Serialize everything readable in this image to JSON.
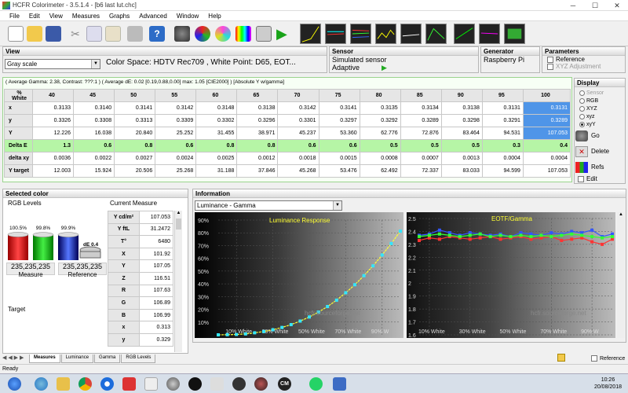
{
  "window": {
    "title": "HCFR Colorimeter - 3.5.1.4 - [b6 last lut.chc]"
  },
  "menu": [
    "File",
    "Edit",
    "View",
    "Measures",
    "Graphs",
    "Advanced",
    "Window",
    "Help"
  ],
  "view": {
    "header": "View",
    "mode": "Gray scale",
    "colorspace": "Color Space: HDTV Rec709 , White Point: D65, EOT..."
  },
  "sensor": {
    "header": "Sensor",
    "name": "Simulated sensor",
    "mode": "Adaptive"
  },
  "generator": {
    "header": "Generator",
    "name": "Raspberry Pi"
  },
  "parameters": {
    "header": "Parameters",
    "reference": "Reference",
    "xyz_adjust": "XYZ Adjustment"
  },
  "grid": {
    "summary": "( Average Gamma: 2.38, Contrast: ???:1 ) ( Average dE: 0.02 [0.19,0.88,0.00] max: 1.05 [CIE2000] ) [Absolute Y w/gamma]",
    "corner": "% White",
    "columns": [
      "40",
      "45",
      "50",
      "55",
      "60",
      "65",
      "70",
      "75",
      "80",
      "85",
      "90",
      "95",
      "100"
    ],
    "rows": [
      {
        "label": "x",
        "values": [
          "0.3133",
          "0.3140",
          "0.3141",
          "0.3142",
          "0.3148",
          "0.3138",
          "0.3142",
          "0.3141",
          "0.3135",
          "0.3134",
          "0.3138",
          "0.3131",
          "0.3131"
        ]
      },
      {
        "label": "y",
        "values": [
          "0.3326",
          "0.3308",
          "0.3313",
          "0.3309",
          "0.3302",
          "0.3296",
          "0.3301",
          "0.3297",
          "0.3292",
          "0.3289",
          "0.3298",
          "0.3291",
          "0.3289"
        ]
      },
      {
        "label": "Y",
        "values": [
          "12.226",
          "16.038",
          "20.840",
          "25.252",
          "31.455",
          "38.971",
          "45.237",
          "53.360",
          "62.776",
          "72.876",
          "83.464",
          "94.531",
          "107.053"
        ]
      },
      {
        "label": "Delta E",
        "values": [
          "1.3",
          "0.6",
          "0.8",
          "0.6",
          "0.8",
          "0.8",
          "0.6",
          "0.6",
          "0.5",
          "0.5",
          "0.5",
          "0.3",
          "0.4"
        ]
      },
      {
        "label": "delta xy",
        "values": [
          "0.0036",
          "0.0022",
          "0.0027",
          "0.0024",
          "0.0025",
          "0.0012",
          "0.0018",
          "0.0015",
          "0.0008",
          "0.0007",
          "0.0013",
          "0.0004",
          "0.0004"
        ]
      },
      {
        "label": "Y target",
        "values": [
          "12.003",
          "15.924",
          "20.506",
          "25.268",
          "31.188",
          "37.846",
          "45.268",
          "53.476",
          "62.492",
          "72.337",
          "83.033",
          "94.599",
          "107.053"
        ]
      }
    ]
  },
  "display_panel": {
    "header": "Display",
    "options": [
      "Sensor",
      "RGB",
      "XYZ",
      "xyz",
      "xyY"
    ],
    "go": "Go",
    "delete": "Delete",
    "refs": "Refs",
    "edit": "Edit"
  },
  "selected": {
    "header": "Selected color",
    "rgb_levels": "RGB Levels",
    "bars": [
      {
        "label": "100.5%",
        "value": 100.5
      },
      {
        "label": "99.8%",
        "value": 99.8
      },
      {
        "label": "99.9%",
        "value": 99.9
      }
    ],
    "de": "dE 0.4",
    "measure_value": "235,235,235",
    "measure_label": "Measure",
    "reference_value": "235,235,235",
    "reference_label": "Reference",
    "target": "Target",
    "current_header": "Current Measure",
    "measures": [
      {
        "label": "Y cd/m²",
        "value": "107.053"
      },
      {
        "label": "Y ftL",
        "value": "31.2472"
      },
      {
        "label": "T°",
        "value": "6480"
      },
      {
        "label": "X",
        "value": "101.92"
      },
      {
        "label": "Y",
        "value": "107.05"
      },
      {
        "label": "Z",
        "value": "116.51"
      },
      {
        "label": "R",
        "value": "107.63"
      },
      {
        "label": "G",
        "value": "106.89"
      },
      {
        "label": "B",
        "value": "106.99"
      },
      {
        "label": "x",
        "value": "0.313"
      },
      {
        "label": "y",
        "value": "0.329"
      }
    ]
  },
  "information": {
    "header": "Information",
    "graph_select": "Luminance - Gamma",
    "lum_title": "Luminance Response",
    "lum_yticks": [
      "90%",
      "80%",
      "70%",
      "60%",
      "50%",
      "40%",
      "30%",
      "20%",
      "10%"
    ],
    "lum_xticks": [
      "10% White",
      "30% White",
      "50% White",
      "70% White",
      "90% W"
    ],
    "eotf_title": "EOTF/Gamma",
    "eotf_yticks": [
      "2.5",
      "2.4",
      "2.3",
      "2.2",
      "2.1",
      "2",
      "1.9",
      "1.8",
      "1.7",
      "1.6"
    ],
    "eotf_xticks": [
      "10% White",
      "30% White",
      "50% White",
      "70% White",
      "90% W"
    ],
    "watermark": "hcfr.sourceforge.net"
  },
  "chart_data": [
    {
      "type": "line",
      "title": "Luminance Response",
      "x": [
        0,
        5,
        10,
        15,
        20,
        25,
        30,
        35,
        40,
        45,
        50,
        55,
        60,
        65,
        70,
        75,
        80,
        85,
        90,
        95,
        100
      ],
      "series": [
        {
          "values": [
            0,
            0.1,
            0.3,
            0.7,
            1.6,
            2.6,
            4,
            5.8,
            8,
            10.8,
            14,
            17.8,
            22.2,
            27.2,
            33,
            39.3,
            46.4,
            54.1,
            62.6,
            71.6,
            81.3
          ]
        }
      ],
      "ylim": [
        0,
        90
      ]
    },
    {
      "type": "line",
      "title": "EOTF/Gamma",
      "x": [
        5,
        10,
        15,
        20,
        25,
        30,
        35,
        40,
        45,
        50,
        55,
        60,
        65,
        70,
        75,
        80,
        85,
        90,
        95,
        100
      ],
      "series": [
        {
          "values": [
            2.37,
            2.38,
            2.41,
            2.39,
            2.37,
            2.39,
            2.38,
            2.37,
            2.38,
            2.36,
            2.39,
            2.38,
            2.37,
            2.39,
            2.38,
            2.4,
            2.39,
            2.41,
            2.36,
            2.38
          ]
        },
        {
          "values": [
            2.33,
            2.35,
            2.34,
            2.36,
            2.35,
            2.34,
            2.35,
            2.36,
            2.34,
            2.35,
            2.36,
            2.34,
            2.35,
            2.36,
            2.33,
            2.34,
            2.35,
            2.32,
            2.3,
            2.34
          ]
        },
        {
          "values": [
            2.36,
            2.37,
            2.38,
            2.37,
            2.36,
            2.37,
            2.38,
            2.36,
            2.37,
            2.36,
            2.37,
            2.36,
            2.37,
            2.36,
            2.37,
            2.38,
            2.37,
            2.36,
            2.35,
            2.36
          ]
        }
      ],
      "ylim": [
        1.6,
        2.5
      ]
    }
  ],
  "tabs": [
    "Measures",
    "Luminance",
    "Gamma",
    "RGB Levels"
  ],
  "status": {
    "text": "Ready",
    "reference": "Reference"
  },
  "clock": {
    "time": "10:26",
    "date": "20/08/2018"
  }
}
